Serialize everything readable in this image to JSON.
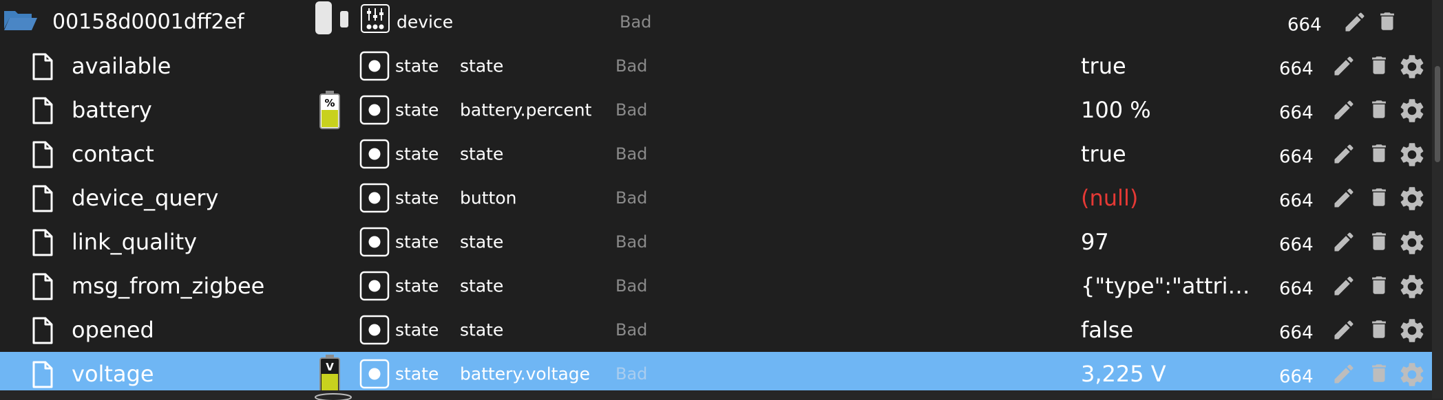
{
  "device_row": {
    "name": "00158d0001dff2ef",
    "type": "device",
    "status": "Bad",
    "ack": "664"
  },
  "rows": [
    {
      "name": "available",
      "type": "state",
      "role": "state",
      "status": "Bad",
      "value": "true",
      "ack": "664",
      "icon": null
    },
    {
      "name": "battery",
      "type": "state",
      "role": "battery.percent",
      "status": "Bad",
      "value": "100 %",
      "ack": "664",
      "icon": "battery-percent-icon"
    },
    {
      "name": "contact",
      "type": "state",
      "role": "state",
      "status": "Bad",
      "value": "true",
      "ack": "664",
      "icon": null
    },
    {
      "name": "device_query",
      "type": "state",
      "role": "button",
      "status": "Bad",
      "value": "(null)",
      "ack": "664",
      "icon": null
    },
    {
      "name": "link_quality",
      "type": "state",
      "role": "state",
      "status": "Bad",
      "value": "97",
      "ack": "664",
      "icon": null
    },
    {
      "name": "msg_from_zigbee",
      "type": "state",
      "role": "state",
      "status": "Bad",
      "value": "{\"type\":\"attribut…",
      "ack": "664",
      "icon": null
    },
    {
      "name": "opened",
      "type": "state",
      "role": "state",
      "status": "Bad",
      "value": "false",
      "ack": "664",
      "icon": null
    },
    {
      "name": "voltage",
      "type": "state",
      "role": "battery.voltage",
      "status": "Bad",
      "value": "3,225 V",
      "ack": "664",
      "icon": "battery-voltage-icon",
      "selected": true
    }
  ],
  "colors": {
    "background": "#1f1f1f",
    "selected_row": "#6fb6f4",
    "status_text": "#8a8a8a",
    "null_value": "#e53935",
    "folder_icon": "#4a86c5",
    "battery_fill": "#c8d11e"
  }
}
